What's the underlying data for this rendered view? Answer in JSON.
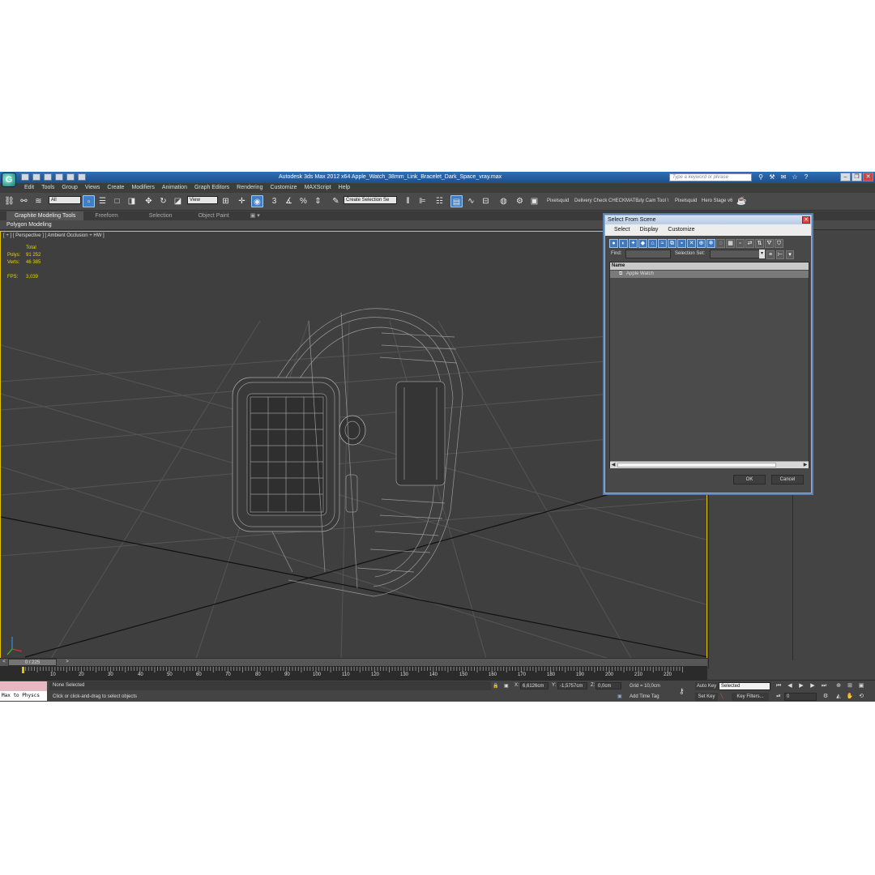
{
  "app": {
    "title": "Autodesk 3ds Max  2012 x64       Apple_Watch_38mm_Link_Bracelet_Dark_Space_vray.max",
    "logo_letter": "G",
    "search_placeholder": "Type a keyword or phrase"
  },
  "menu": [
    "Edit",
    "Tools",
    "Group",
    "Views",
    "Create",
    "Modifiers",
    "Animation",
    "Graph Editors",
    "Rendering",
    "Customize",
    "MAXScript",
    "Help"
  ],
  "toolbar": {
    "filter_value": "All",
    "refcoord_value": "View",
    "selset_value": "Create Selection Se",
    "plugin_labels": [
      "Pixelsquid",
      "Delivery Check",
      "CHECKMATE",
      "uty Cam Tool \\",
      "Pixelsquid",
      "Hero Stage v6"
    ],
    "snap_label": "3"
  },
  "ribbon": {
    "tabs": [
      "Graphite Modeling Tools",
      "Freeform",
      "Selection",
      "Object Paint"
    ],
    "panel_label": "Polygon Modeling"
  },
  "viewport": {
    "label": "[ + ] [ Perspective ] [ Ambient Occlusion + HW ]",
    "stats": {
      "total_label": "Total",
      "polys_label": "Polys:",
      "polys_value": "91 252",
      "verts_label": "Verts:",
      "verts_value": "46 385",
      "fps_label": "FPS:",
      "fps_value": "3,039"
    }
  },
  "dialog": {
    "title": "Select From Scene",
    "menu": [
      "Select",
      "Display",
      "Customize"
    ],
    "find_label": "Find:",
    "selection_set_label": "Selection Set:",
    "column_name": "Name",
    "items": [
      "Apple Watch"
    ],
    "ok_label": "OK",
    "cancel_label": "Cancel"
  },
  "timeline": {
    "slider_value": "0 / 225",
    "ticks": [
      "10",
      "20",
      "30",
      "40",
      "50",
      "60",
      "70",
      "80",
      "90",
      "100",
      "110",
      "120",
      "130",
      "140",
      "150",
      "160",
      "170",
      "180",
      "190",
      "200",
      "210",
      "220"
    ]
  },
  "status": {
    "script_listener": "Max to Physcs",
    "selection_info": "None Selected",
    "prompt": "Click or click-and-drag to select objects",
    "x_label": "X:",
    "x_value": "6,6126cm",
    "y_label": "Y:",
    "y_value": "-1,5757cm",
    "z_label": "Z:",
    "z_value": "0,0cm",
    "grid": "Grid = 10,0cm",
    "add_time_tag": "Add Time Tag",
    "auto_key": "Auto Key",
    "set_key": "Set Key",
    "selected_dd": "Selected",
    "key_filters": "Key Filters...",
    "frame_value": "0"
  }
}
